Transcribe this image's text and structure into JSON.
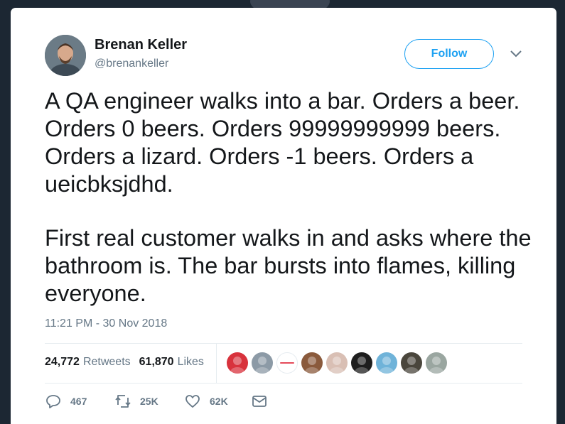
{
  "author": {
    "name": "Brenan Keller",
    "handle": "@brenankeller",
    "avatar_icon": "profile-photo"
  },
  "follow_label": "Follow",
  "tweet": {
    "paragraphs": [
      "A QA engineer walks into a bar. Orders a beer. Orders 0 beers. Orders 99999999999 beers. Orders a lizard. Orders -1 beers. Orders a ueicbksjdhd.",
      "First real customer walks in and asks where the bathroom is. The bar bursts into flames, killing everyone."
    ],
    "timestamp": "11:21 PM - 30 Nov 2018"
  },
  "stats": {
    "retweets_count": "24,772",
    "retweets_label": "Retweets",
    "likes_count": "61,870",
    "likes_label": "Likes"
  },
  "likers": [
    {
      "icon": "red-mask-avatar",
      "color": "#d8323c"
    },
    {
      "icon": "person-avatar",
      "color": "#8c9aa6"
    },
    {
      "icon": "mozilla-logo-avatar",
      "color": "#ffffff"
    },
    {
      "icon": "bearded-person-avatar",
      "color": "#8a5a3c"
    },
    {
      "icon": "person-avatar",
      "color": "#d9bfb4"
    },
    {
      "icon": "sketch-face-avatar",
      "color": "#1e1e1e"
    },
    {
      "icon": "bird-avatar",
      "color": "#6fb3d9"
    },
    {
      "icon": "dark-portrait-avatar",
      "color": "#4a463c"
    },
    {
      "icon": "person-avatar",
      "color": "#9aa6a0"
    }
  ],
  "actions": {
    "reply_count": "467",
    "retweet_count": "25K",
    "like_count": "62K"
  },
  "colors": {
    "accent": "#1da1f2",
    "secondary_text": "#657786",
    "primary_text": "#14171a",
    "backdrop": "#1c2733"
  }
}
